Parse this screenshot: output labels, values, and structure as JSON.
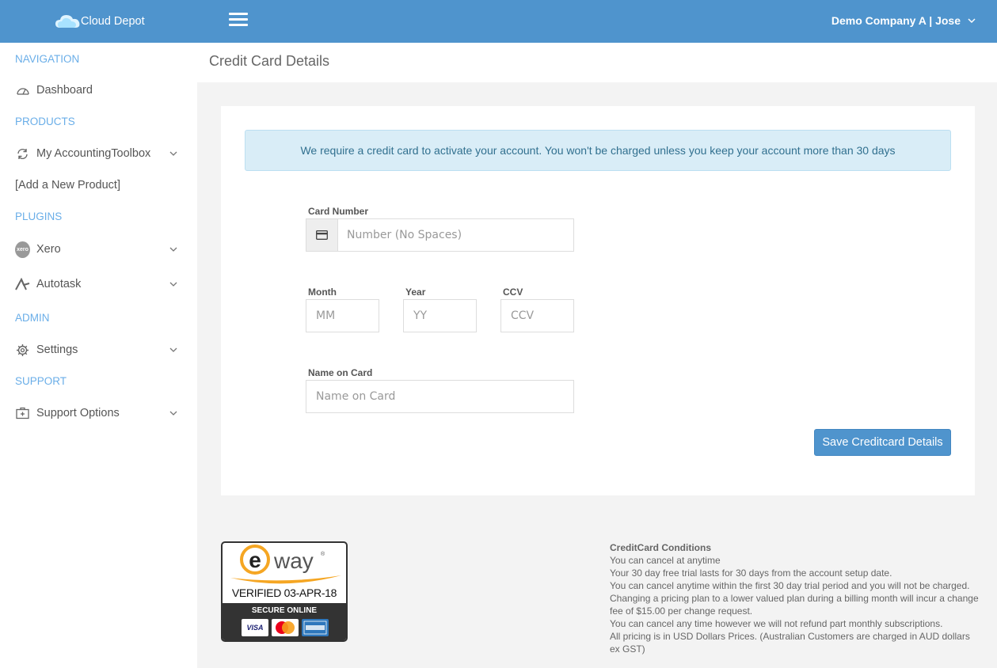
{
  "header": {
    "brand": "Cloud Depot",
    "user": "Demo Company A | Jose"
  },
  "sidebar": {
    "sections": {
      "navigation": "NAVIGATION",
      "products": "PRODUCTS",
      "plugins": "PLUGINS",
      "admin": "ADMIN",
      "support": "SUPPORT"
    },
    "items": {
      "dashboard": "Dashboard",
      "accounting_toolbox": "My AccountingToolbox",
      "add_product": "[Add a New Product]",
      "xero": "Xero",
      "autotask": "Autotask",
      "settings": "Settings",
      "support_options": "Support Options"
    },
    "icons": {
      "dashboard": "gauge-icon",
      "accounting_toolbox": "sync-icon",
      "xero": "xero-logo-icon",
      "autotask": "autotask-logo-icon",
      "settings": "gear-icon",
      "support_options": "first-aid-icon"
    }
  },
  "page": {
    "title": "Credit Card Details"
  },
  "form": {
    "notice": "We require a credit card to activate your account. You won't be charged unless you keep your account more than 30 days",
    "card_number_label": "Card Number",
    "card_number_placeholder": "Number (No Spaces)",
    "month_label": "Month",
    "month_placeholder": "MM",
    "year_label": "Year",
    "year_placeholder": "YY",
    "ccv_label": "CCV",
    "ccv_placeholder": "CCV",
    "name_label": "Name on Card",
    "name_placeholder": "Name on Card",
    "save_button": "Save Creditcard Details"
  },
  "eway_badge": {
    "logo": "eway",
    "verified": "VERIFIED 03-APR-18",
    "secure": "SECURE ONLINE",
    "cards": [
      "VISA",
      "MasterCard",
      "AMERICAN EXPRESS"
    ]
  },
  "conditions": {
    "title": "CreditCard Conditions",
    "lines": [
      "You can cancel at anytime",
      "Your 30 day free trial lasts for 30 days from the account setup date.",
      "You can cancel anytime within the first 30 day trial period and you will not be charged.",
      "Changing a pricing plan to a lower valued plan during a billing month will incur a change fee of $15.00 per change request.",
      "You can cancel any time however we will not refund part monthly subscriptions.",
      "All pricing is in USD Dollars Prices. (Australian Customers are charged in AUD dollars ex GST)"
    ]
  },
  "colors": {
    "header_bg": "#4f94cd",
    "section_label": "#6aaee8",
    "alert_bg": "#d9edf7",
    "alert_text": "#31708f",
    "content_bg": "#f3f3f3",
    "eway_orange": "#f5a623"
  }
}
